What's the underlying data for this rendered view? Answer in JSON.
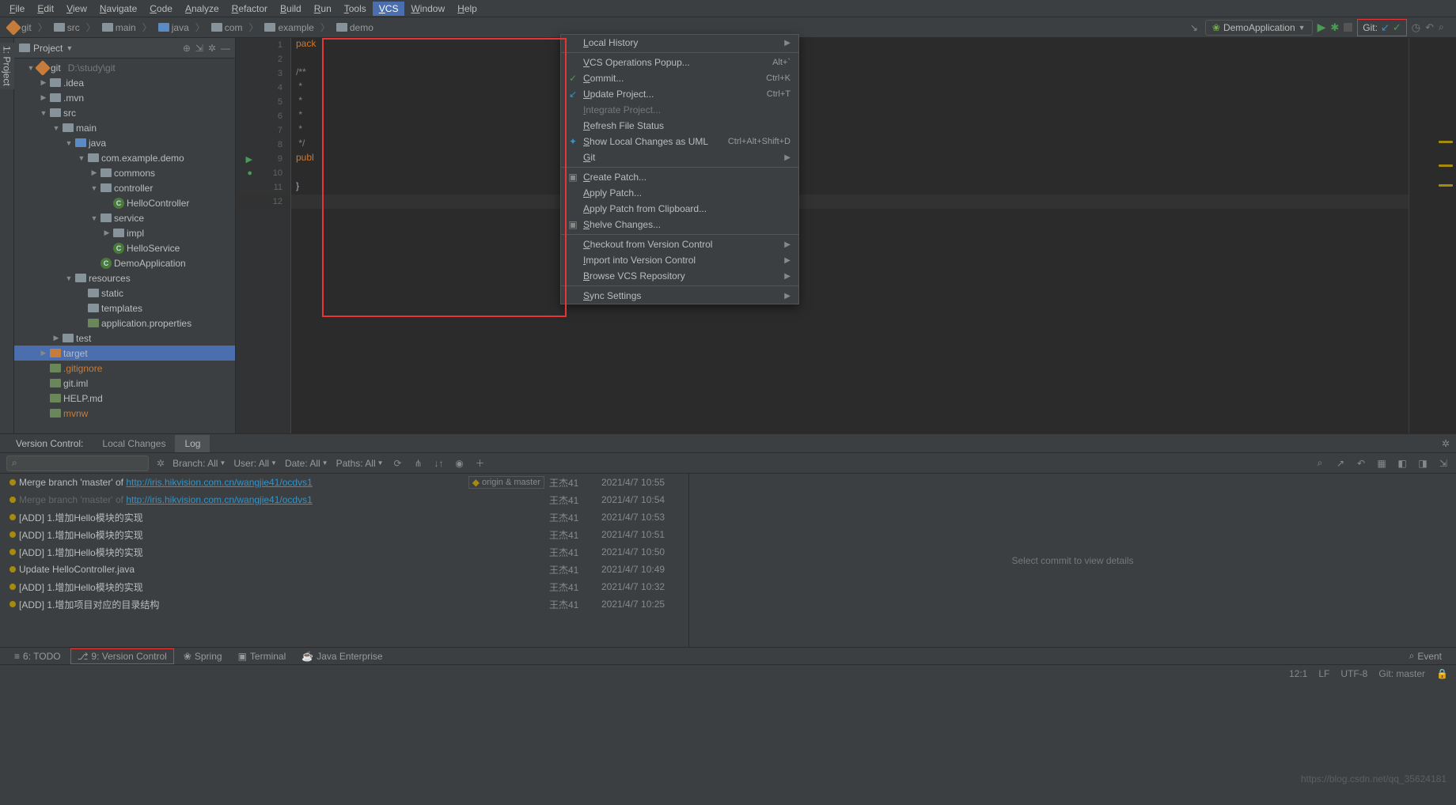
{
  "menubar": [
    "File",
    "Edit",
    "View",
    "Navigate",
    "Code",
    "Analyze",
    "Refactor",
    "Build",
    "Run",
    "Tools",
    "VCS",
    "Window",
    "Help"
  ],
  "menubar_active_index": 10,
  "breadcrumb": [
    {
      "icon": "git",
      "label": "git"
    },
    {
      "icon": "folder",
      "label": "src"
    },
    {
      "icon": "folder",
      "label": "main"
    },
    {
      "icon": "folder-blue",
      "label": "java"
    },
    {
      "icon": "folder",
      "label": "com"
    },
    {
      "icon": "folder",
      "label": "example"
    },
    {
      "icon": "folder",
      "label": "demo"
    }
  ],
  "run_config": {
    "name": "DemoApplication"
  },
  "git_box": {
    "label": "Git:"
  },
  "project": {
    "title": "Project",
    "root": {
      "name": "git",
      "path": "D:\\study\\git"
    },
    "tree": [
      {
        "indent": 1,
        "arrow": "▼",
        "icon": "git",
        "label": "git",
        "suffix": "D:\\study\\git"
      },
      {
        "indent": 2,
        "arrow": "▶",
        "icon": "folder",
        "label": ".idea"
      },
      {
        "indent": 2,
        "arrow": "▶",
        "icon": "folder",
        "label": ".mvn"
      },
      {
        "indent": 2,
        "arrow": "▼",
        "icon": "folder",
        "label": "src"
      },
      {
        "indent": 3,
        "arrow": "▼",
        "icon": "folder",
        "label": "main"
      },
      {
        "indent": 4,
        "arrow": "▼",
        "icon": "folder-blue",
        "label": "java"
      },
      {
        "indent": 5,
        "arrow": "▼",
        "icon": "folder",
        "label": "com.example.demo"
      },
      {
        "indent": 6,
        "arrow": "▶",
        "icon": "folder",
        "label": "commons"
      },
      {
        "indent": 6,
        "arrow": "▼",
        "icon": "folder",
        "label": "controller"
      },
      {
        "indent": 7,
        "arrow": "",
        "icon": "class-c",
        "label": "HelloController"
      },
      {
        "indent": 6,
        "arrow": "▼",
        "icon": "folder",
        "label": "service"
      },
      {
        "indent": 7,
        "arrow": "▶",
        "icon": "folder",
        "label": "impl"
      },
      {
        "indent": 7,
        "arrow": "",
        "icon": "class-s",
        "label": "HelloService"
      },
      {
        "indent": 6,
        "arrow": "",
        "icon": "class-c",
        "label": "DemoApplication"
      },
      {
        "indent": 4,
        "arrow": "▼",
        "icon": "folder",
        "label": "resources"
      },
      {
        "indent": 5,
        "arrow": "",
        "icon": "folder",
        "label": "static"
      },
      {
        "indent": 5,
        "arrow": "",
        "icon": "folder",
        "label": "templates"
      },
      {
        "indent": 5,
        "arrow": "",
        "icon": "file",
        "label": "application.properties"
      },
      {
        "indent": 3,
        "arrow": "▶",
        "icon": "folder",
        "label": "test"
      },
      {
        "indent": 2,
        "arrow": "▶",
        "icon": "folder-orange",
        "label": "target",
        "sel": true
      },
      {
        "indent": 2,
        "arrow": "",
        "icon": "file",
        "label": ".gitignore",
        "orange": true
      },
      {
        "indent": 2,
        "arrow": "",
        "icon": "file",
        "label": "git.iml"
      },
      {
        "indent": 2,
        "arrow": "",
        "icon": "file",
        "label": "HELP.md"
      },
      {
        "indent": 2,
        "arrow": "",
        "icon": "file",
        "label": "mvnw",
        "orange": true
      }
    ]
  },
  "editor": {
    "lines": [
      "1",
      "2",
      "3",
      "4",
      "5",
      "6",
      "7",
      "8",
      "9",
      "10",
      "11",
      "12"
    ],
    "code": [
      "pack",
      "",
      "/**",
      " *",
      " *",
      " *",
      " *",
      " */",
      "publ",
      "",
      "}",
      ""
    ],
    "hl_index": 11
  },
  "dropdown": [
    {
      "type": "item",
      "label": "Local History",
      "arrow": true
    },
    {
      "type": "sep"
    },
    {
      "type": "item",
      "label": "VCS Operations Popup...",
      "short": "Alt+`"
    },
    {
      "type": "item",
      "label": "Commit...",
      "icon": "✓",
      "icon_color": "#499c54",
      "short": "Ctrl+K"
    },
    {
      "type": "item",
      "label": "Update Project...",
      "icon": "↙",
      "icon_color": "#3592c4",
      "short": "Ctrl+T"
    },
    {
      "type": "item",
      "label": "Integrate Project...",
      "disabled": true
    },
    {
      "type": "item",
      "label": "Refresh File Status"
    },
    {
      "type": "item",
      "label": "Show Local Changes as UML",
      "icon": "✦",
      "icon_color": "#3592c4",
      "short": "Ctrl+Alt+Shift+D"
    },
    {
      "type": "item",
      "label": "Git",
      "arrow": true
    },
    {
      "type": "sep"
    },
    {
      "type": "item",
      "label": "Create Patch...",
      "icon": "▣",
      "icon_color": "#888"
    },
    {
      "type": "item",
      "label": "Apply Patch..."
    },
    {
      "type": "item",
      "label": "Apply Patch from Clipboard..."
    },
    {
      "type": "item",
      "label": "Shelve Changes...",
      "icon": "▣",
      "icon_color": "#888"
    },
    {
      "type": "sep"
    },
    {
      "type": "item",
      "label": "Checkout from Version Control",
      "arrow": true
    },
    {
      "type": "item",
      "label": "Import into Version Control",
      "arrow": true
    },
    {
      "type": "item",
      "label": "Browse VCS Repository",
      "arrow": true
    },
    {
      "type": "sep"
    },
    {
      "type": "item",
      "label": "Sync Settings",
      "arrow": true
    }
  ],
  "vc": {
    "title": "Version Control:",
    "tabs": [
      "Local Changes",
      "Log"
    ],
    "active_tab": 1,
    "filters": {
      "branch": "Branch: All",
      "user": "User: All",
      "date": "Date: All",
      "paths": "Paths: All"
    },
    "detail_placeholder": "Select commit to view details",
    "commits": [
      {
        "msg": "Merge branch 'master' of ",
        "link": "http://iris.hikvision.com.cn/wangjie41/ocdvs1",
        "branch": "origin & master",
        "author": "王杰41",
        "date": "2021/4/7 10:55"
      },
      {
        "msg": "Merge branch 'master' of ",
        "link": "http://iris.hikvision.com.cn/wangjie41/ocdvs1",
        "dim": true,
        "author": "王杰41",
        "date": "2021/4/7 10:54"
      },
      {
        "msg": "[ADD] 1.增加Hello模块的实现",
        "author": "王杰41",
        "date": "2021/4/7 10:53"
      },
      {
        "msg": "[ADD] 1.增加Hello模块的实现",
        "author": "王杰41",
        "date": "2021/4/7 10:51"
      },
      {
        "msg": "[ADD] 1.增加Hello模块的实现",
        "author": "王杰41",
        "date": "2021/4/7 10:50"
      },
      {
        "msg": "Update HelloController.java",
        "author": "王杰41",
        "date": "2021/4/7 10:49"
      },
      {
        "msg": "[ADD] 1.增加Hello模块的实现",
        "author": "王杰41",
        "date": "2021/4/7 10:32"
      },
      {
        "msg": "[ADD] 1.增加项目对应的目录结构",
        "author": "王杰41",
        "date": "2021/4/7 10:25"
      }
    ]
  },
  "tools": [
    {
      "label": "6: TODO",
      "icon": "≡"
    },
    {
      "label": "9: Version Control",
      "icon": "⎇",
      "boxed": true
    },
    {
      "label": "Spring",
      "icon": "❀"
    },
    {
      "label": "Terminal",
      "icon": "▣"
    },
    {
      "label": "Java Enterprise",
      "icon": "☕"
    }
  ],
  "event_label": "Event",
  "status": {
    "pos": "12:1",
    "encoding": "LF",
    "charset": "UTF-8",
    "git": "Git: master"
  },
  "watermark": "https://blog.csdn.net/qq_35624181"
}
